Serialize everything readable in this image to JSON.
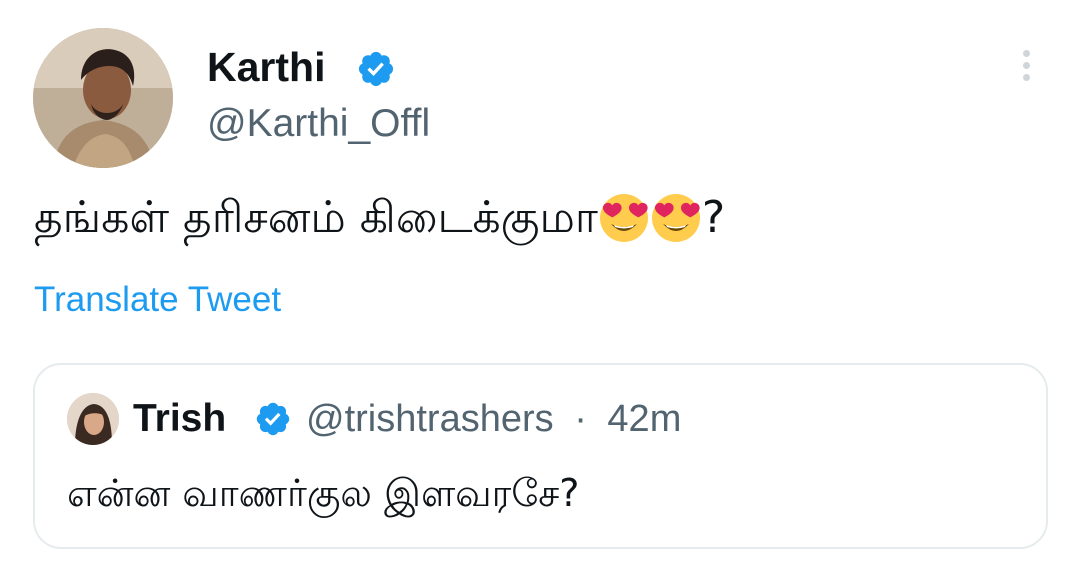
{
  "tweet": {
    "author": {
      "display_name": "Karthi",
      "handle": "@Karthi_Offl",
      "verified_icon": "verified-badge-icon",
      "avatar": "profile-photo"
    },
    "text_before_emoji": "தங்கள் தரிசனம்  கிடைக்குமா ",
    "emojis": [
      "smiling-face-with-heart-eyes",
      "smiling-face-with-heart-eyes"
    ],
    "text_after_emoji": "?",
    "translate_label": "Translate Tweet",
    "more_icon": "more-options-vertical-icon"
  },
  "quoted_tweet": {
    "display_name": "Trish",
    "handle": "@trishtrashers",
    "separator": "·",
    "time": "42m",
    "text": "என்ன வாணர்குல இளவரசே?",
    "verified_icon": "verified-badge-icon"
  },
  "colors": {
    "verified_blue": "#1d9bf0",
    "link_blue": "#1d9bf0",
    "secondary_text": "#536471",
    "border": "#e6ebee"
  }
}
